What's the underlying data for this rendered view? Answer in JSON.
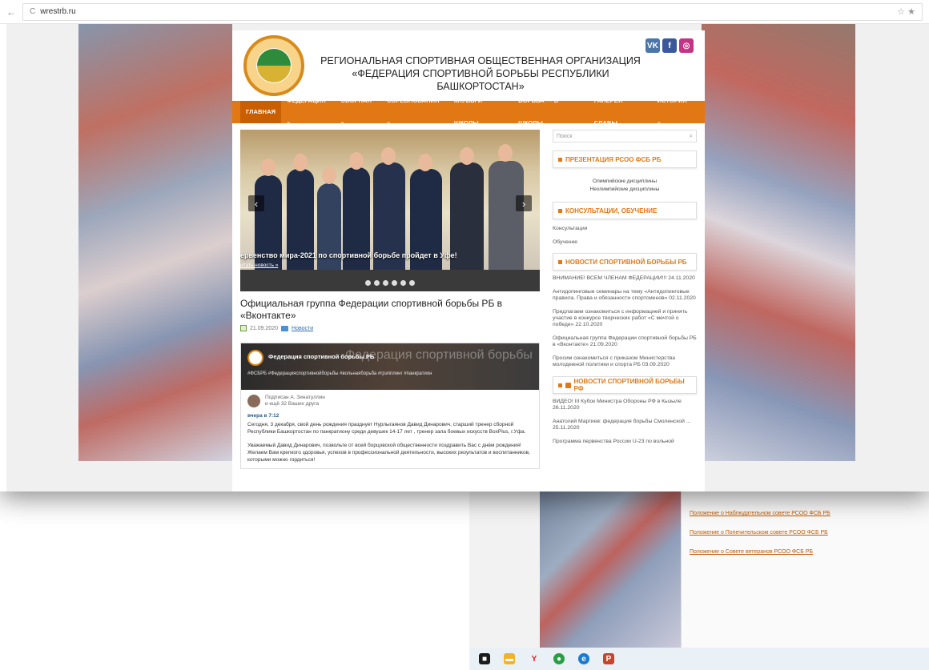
{
  "browser": {
    "back_glyph": "←",
    "reload_glyph": "C",
    "url": "wrestrb.ru",
    "star_glyph": "☆ ★"
  },
  "site": {
    "title_line1": "РЕГИОНАЛЬНАЯ СПОРТИВНАЯ ОБЩЕСТВЕННАЯ ОРГАНИЗАЦИЯ",
    "title_line2": "«ФЕДЕРАЦИЯ СПОРТИВНОЙ БОРЬБЫ РЕСПУБЛИКИ БАШКОРТОСТАН»",
    "socials": [
      "VK",
      "f",
      "◎"
    ],
    "social_colors": [
      "#4a76a8",
      "#3b5998",
      "#c13584"
    ],
    "menu": [
      "ГЛАВНАЯ",
      "ФЕДЕРАЦИЯ »",
      "СБОРНАЯ »",
      "СОРЕВНОВАНИЯ »",
      "КЛУБЫ И ШКОЛЫ",
      "БОРЬБА — В ШКОЛЫ",
      "ГАЛЕРЕЯ СЛАВЫ",
      "ИСТОРИЯ »"
    ]
  },
  "slider": {
    "caption": "ервенство мира-2021 по спортивной борьбе пройдет в Уфе!",
    "more": "итать новость »",
    "prev": "‹",
    "next": "›",
    "dot_count": 6
  },
  "post": {
    "title": "Официальная группа Федерации спортивной борьбы РБ в «Вконтакте»",
    "date": "21.09.2020",
    "category": "Новости"
  },
  "vk": {
    "group_name": "Федерация спортивной борьбы РБ",
    "watermark": "Федерация спортивной борьбы",
    "tags": "#ФСБРБ #Федерацияспортивнойборьбы #вольнаяборьба #грэпплинг #панкратион",
    "subscribed": "Подписан А. Зинатуллин",
    "friends": "и ещё 32 Ваших друга",
    "date": "вчера в 7:12",
    "para1": "Сегодня, 3 декабря, свой день рождения празднует Нурлыгаянов Давид Динарович, старший тренер сборной Республики Башкортостан по панкратиону среди девушек 14-17 лет , тренер зала боевых искусств BoxPlus, г.Уфа.",
    "para2": "Уважаемый Давид Динарович, позвольте от всей борцовской общественности поздравить Вас с днём рождения! Желаем Вам крепкого здоровья, успехов в профессиональной деятельности, высоких результатов и воспитанников, которыми можно гордиться!"
  },
  "sidebar": {
    "search_placeholder": "Поиск",
    "w1_title": "ПРЕЗЕНТАЦИЯ РСОО ФСБ РБ",
    "w1_items": [
      "Олимпийские дисциплины",
      "Неолимпийские дисциплины"
    ],
    "w2_title": "КОНСУЛЬТАЦИИ, ОБУЧЕНИЕ",
    "w2_items": [
      "Консультации",
      "Обучение"
    ],
    "w3_title": "НОВОСТИ СПОРТИВНОЙ БОРЬБЫ РБ",
    "w3_items": [
      "ВНИМАНИЕ! ВСЕМ ЧЛЕНАМ ФЕДЕРАЦИИ!!! 24.11.2020",
      "Антидопинговые семинары на тему «Антидопинговые правила. Права и обязанности спортсменов» 02.11.2020",
      "Предлагаем ознакомиться с информацией и принять участие в конкурсе творческих работ «С мечтой о победе» 22.10.2020",
      "Официальная группа Федерации спортивной борьбы РБ в «Вконтакте» 21.09.2020",
      "Просим ознакомиться с приказом Министерства молодежной политики и спорта РБ 03.09.2020"
    ],
    "w4_title": "НОВОСТИ СПОРТИВНОЙ БОРЬБЫ РФ",
    "w4_items": [
      "ВИДЕО! III Кубок Министра Обороны РФ в Кызыле 26.11.2020",
      "Анатолий Маргиев: федерация борьбы Смоленской ... 25.11.2020",
      "Программа первенства России U-23 по вольной"
    ]
  },
  "back_window": {
    "links": [
      "Положение о Наблюдательном совете РСОО ФСБ РБ",
      "Положение о Попечительском совете РСОО ФСБ РБ",
      "Положение о Совете ветеранов РСОО ФСБ РБ"
    ]
  },
  "taskbar": {
    "icons": [
      "windows-icon",
      "file-explorer-icon",
      "yandex-icon",
      "chrome-icon",
      "edge-icon",
      "powerpoint-icon"
    ],
    "glyphs": [
      "■",
      "▬",
      "Y",
      "●",
      "e",
      "P"
    ],
    "colors": [
      "#1c1c1c",
      "#f0b429",
      "#e01e1e",
      "#2a9d44",
      "#1a7ad4",
      "#c9452a"
    ]
  }
}
